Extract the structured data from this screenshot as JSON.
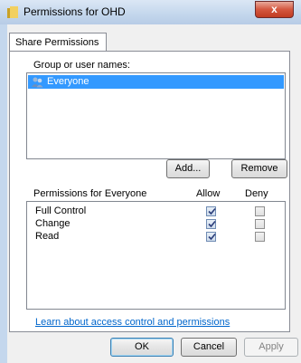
{
  "window": {
    "title": "Permissions for OHD",
    "close_glyph": "x"
  },
  "tabs": [
    {
      "label": "Share Permissions"
    }
  ],
  "groups": {
    "label": "Group or user names:",
    "items": [
      {
        "name": "Everyone",
        "icon": "users-icon",
        "selected": true
      }
    ]
  },
  "buttons": {
    "add": "Add...",
    "remove": "Remove",
    "ok": "OK",
    "cancel": "Cancel",
    "apply": "Apply"
  },
  "permissions": {
    "header": "Permissions for Everyone",
    "allow_label": "Allow",
    "deny_label": "Deny",
    "rows": [
      {
        "name": "Full Control",
        "allow": true,
        "deny": false
      },
      {
        "name": "Change",
        "allow": true,
        "deny": false
      },
      {
        "name": "Read",
        "allow": true,
        "deny": false
      }
    ]
  },
  "link_text": "Learn about access control and permissions",
  "colors": {
    "selection": "#3399ff",
    "link": "#0066cc",
    "close": "#c03c22"
  }
}
